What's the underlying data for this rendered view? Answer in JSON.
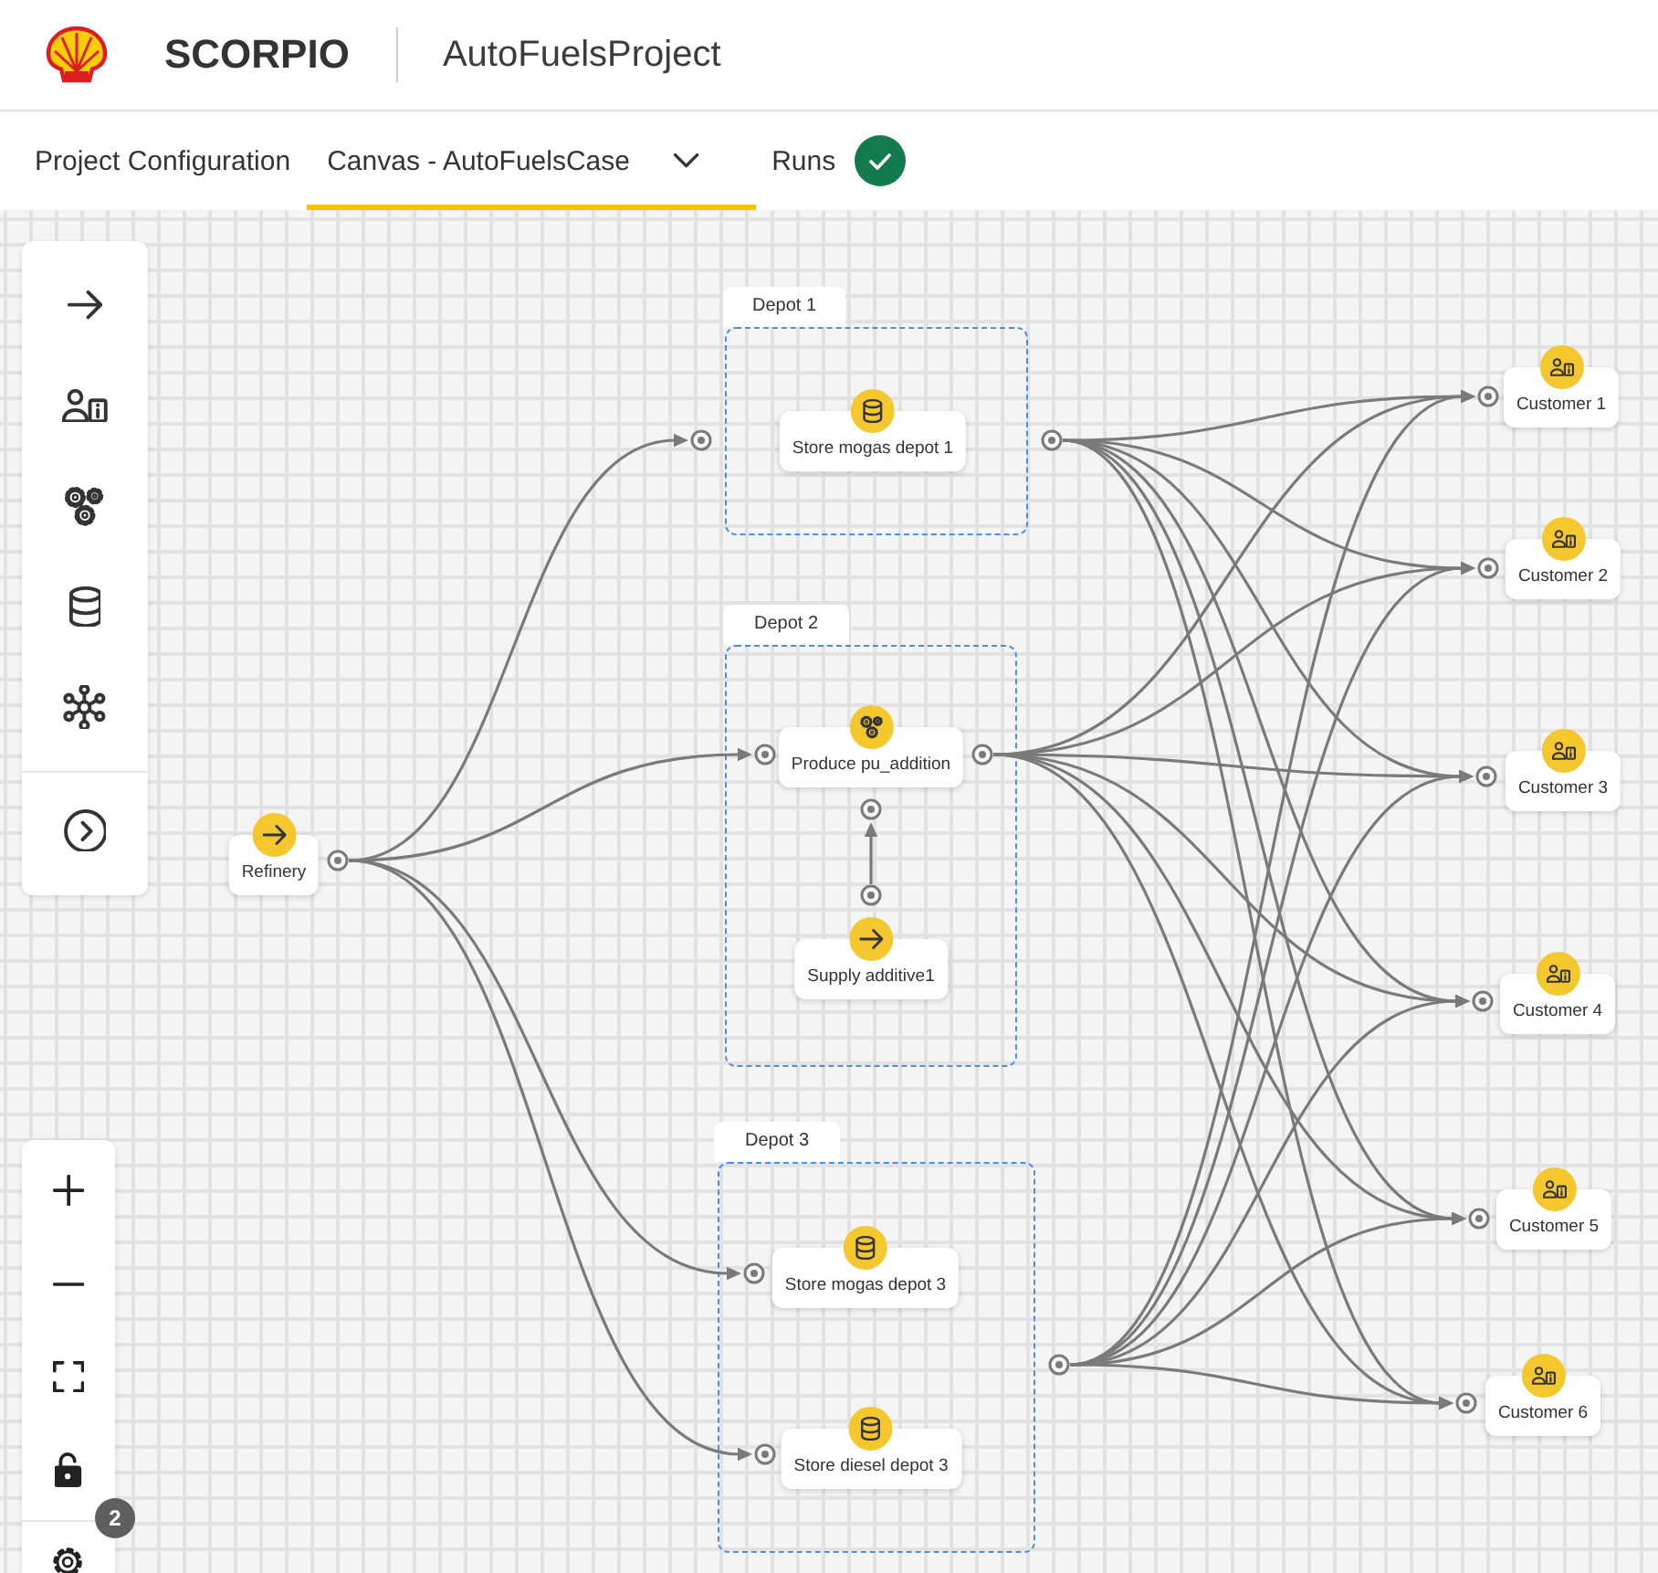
{
  "app": {
    "brand": "SCORPIO",
    "project": "AutoFuelsProject"
  },
  "tabs": [
    {
      "label": "Project Configuration",
      "selected": false,
      "kind": "plain"
    },
    {
      "label": "Canvas - AutoFuelsCase",
      "selected": true,
      "kind": "menu"
    },
    {
      "label": "Runs",
      "selected": false,
      "kind": "status",
      "succeeded": true
    }
  ],
  "canvas": {
    "sources": [
      {
        "label": "Refinery",
        "kind": "supply"
      }
    ],
    "groups": [
      {
        "label": "Depot 1",
        "nodes": [
          {
            "label": "Store mogas depot 1",
            "kind": "storage"
          }
        ]
      },
      {
        "label": "Depot 2",
        "nodes": [
          {
            "label": "Produce pu_addition",
            "kind": "process"
          },
          {
            "label": "Supply additive1",
            "kind": "supply"
          }
        ]
      },
      {
        "label": "Depot 3",
        "nodes": [
          {
            "label": "Store mogas depot 3",
            "kind": "storage"
          },
          {
            "label": "Store diesel depot 3",
            "kind": "storage"
          }
        ]
      }
    ],
    "customers": [
      {
        "label": "Customer 1",
        "kind": "customer"
      },
      {
        "label": "Customer 2",
        "kind": "customer"
      },
      {
        "label": "Customer 3",
        "kind": "customer"
      },
      {
        "label": "Customer 4",
        "kind": "customer"
      },
      {
        "label": "Customer 5",
        "kind": "customer"
      },
      {
        "label": "Customer 6",
        "kind": "customer"
      }
    ]
  },
  "controls": {
    "settings_badge": "2"
  }
}
